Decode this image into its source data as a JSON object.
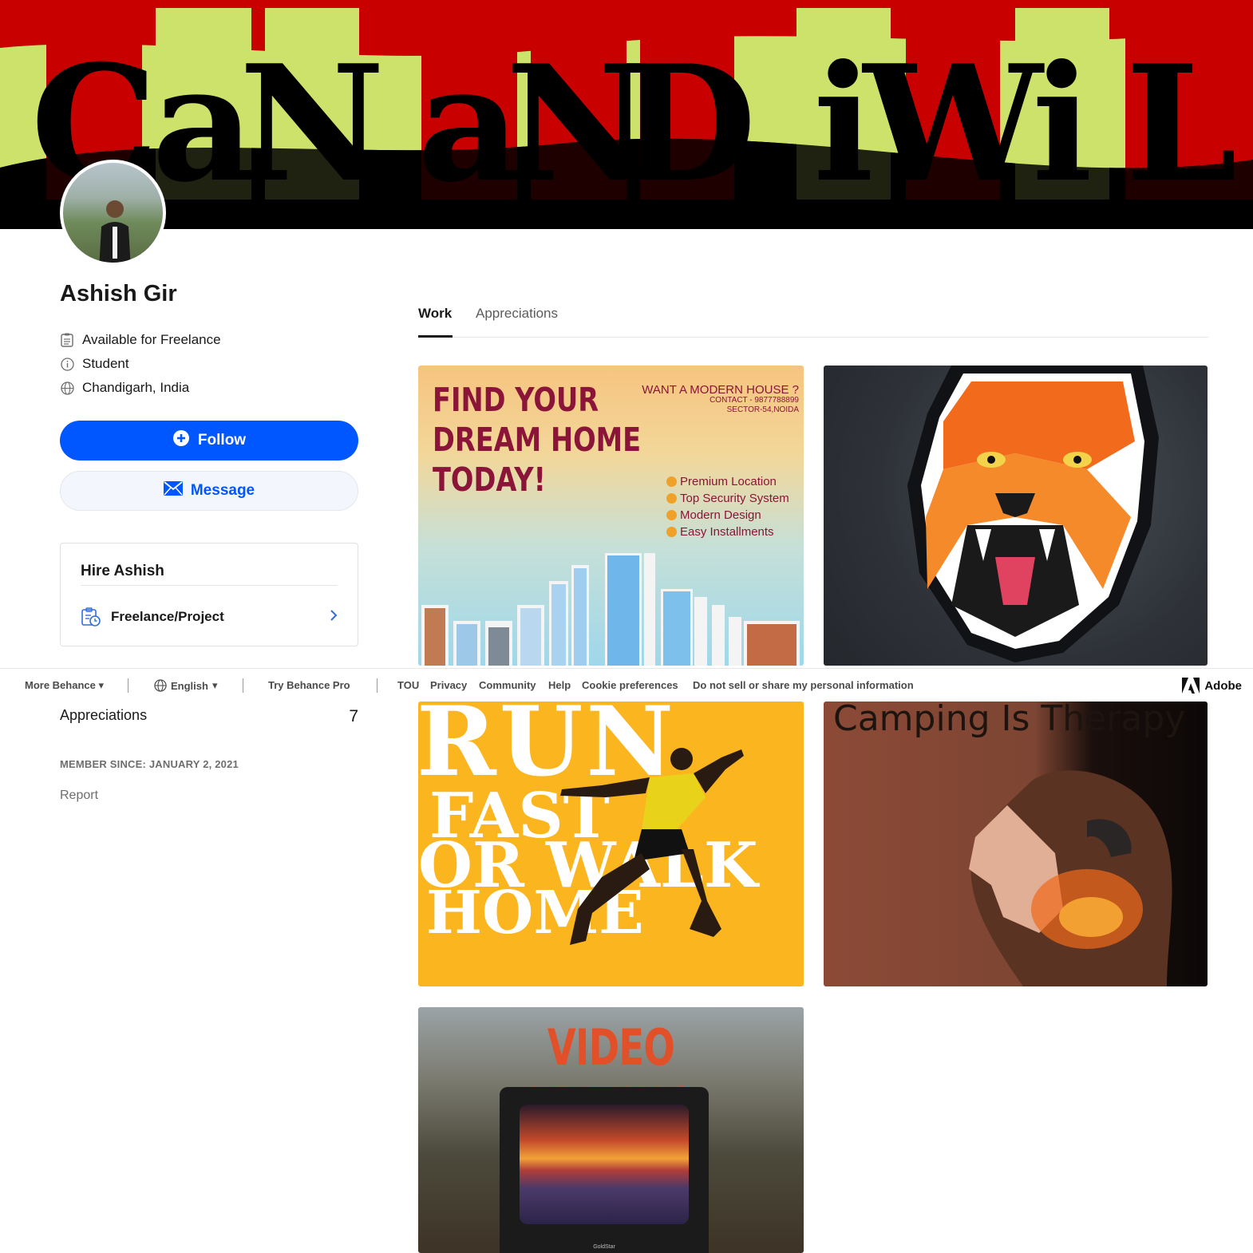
{
  "banner": {
    "words": [
      "Can",
      "aND",
      "i",
      "will"
    ]
  },
  "profile": {
    "name": "Ashish Gir",
    "availability": "Available for Freelance",
    "occupation": "Student",
    "location": "Chandigarh, India",
    "follow_label": "Follow",
    "message_label": "Message"
  },
  "hire": {
    "title": "Hire Ashish",
    "option_label": "Freelance/Project"
  },
  "stats": {
    "appreciations_label": "Appreciations",
    "appreciations_count": "7",
    "member_since": "MEMBER SINCE: JANUARY 2, 2021",
    "report_label": "Report"
  },
  "tabs": [
    {
      "label": "Work",
      "active": true
    },
    {
      "label": "Appreciations",
      "active": false
    }
  ],
  "projects": {
    "dream_home": {
      "headline_1": "FIND YOUR",
      "headline_2": "DREAM HOME",
      "headline_3": "TODAY!",
      "want": "WANT A MODERN HOUSE ?",
      "contact": "CONTACT - 9877788899",
      "sector": "SECTOR-54,NOIDA",
      "features": [
        "Premium Location",
        "Top Security System",
        "Modern Design",
        "Easy Installments"
      ]
    },
    "tiger": {},
    "run": {
      "line_1": "RUN",
      "line_2": "FAST",
      "line_3": "OR WALK",
      "line_4": "HOME"
    },
    "camping": {
      "title": "Camping Is Therapy"
    },
    "video": {
      "title": "VIDEO EDITING",
      "tv_brand": "GoldStar"
    }
  },
  "footer": {
    "more_behance": "More Behance",
    "language": "English",
    "try_pro": "Try Behance Pro",
    "links": [
      "TOU",
      "Privacy",
      "Community",
      "Help",
      "Cookie preferences",
      "Do not sell or share my personal information"
    ],
    "brand": "Adobe"
  },
  "colors": {
    "accent": "#0057ff",
    "banner_red": "#c80000",
    "banner_lime": "#cde26a",
    "text": "#191919"
  }
}
